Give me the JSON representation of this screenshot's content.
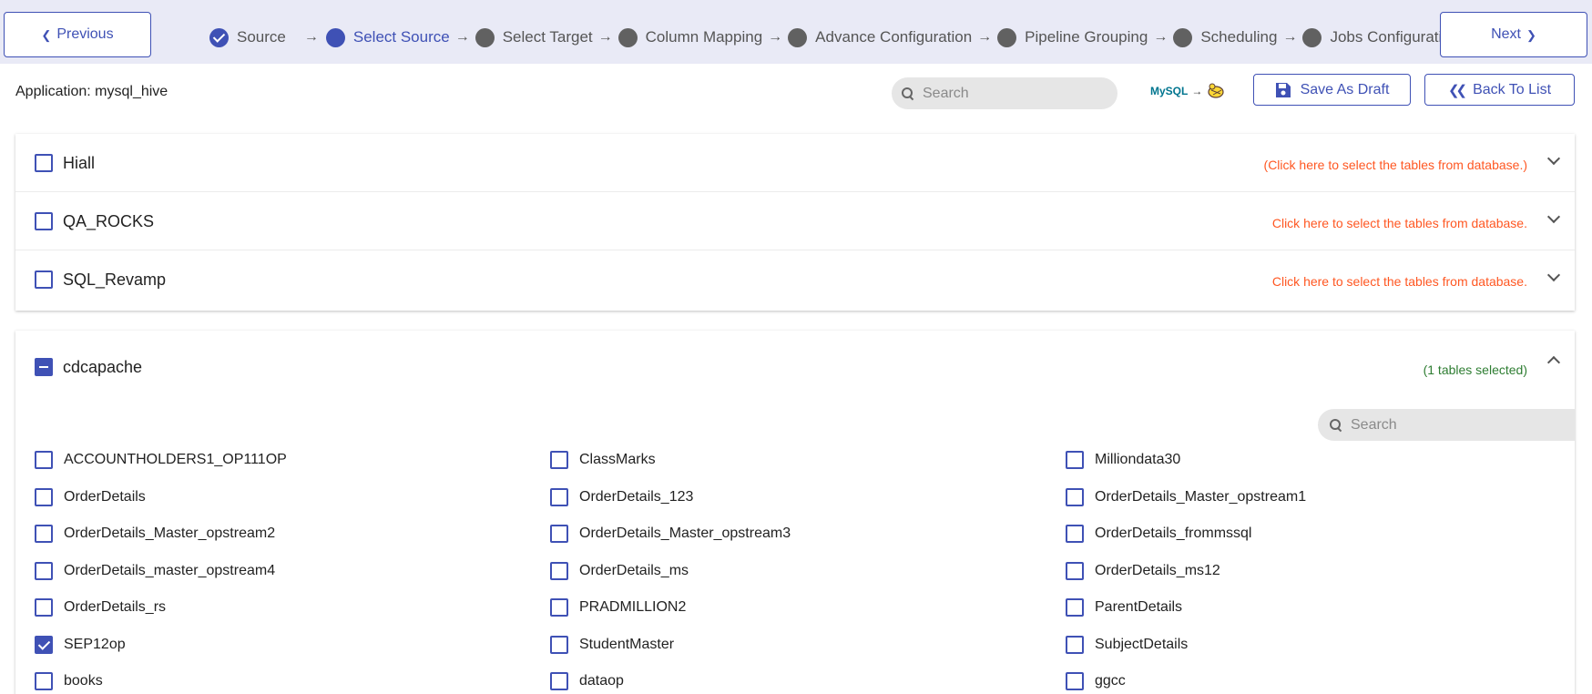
{
  "nav": {
    "previous_label": "Previous",
    "next_label": "Next"
  },
  "stepper": {
    "steps": [
      {
        "label": "Source",
        "state": "done"
      },
      {
        "label": "Select Source",
        "state": "active"
      },
      {
        "label": "Select Target",
        "state": "pending"
      },
      {
        "label": "Column Mapping",
        "state": "pending"
      },
      {
        "label": "Advance Configuration",
        "state": "pending"
      },
      {
        "label": "Pipeline Grouping",
        "state": "pending"
      },
      {
        "label": "Scheduling",
        "state": "pending"
      },
      {
        "label": "Jobs Configuration",
        "state": "pending"
      }
    ],
    "arrow": "→"
  },
  "header": {
    "application_label": "Application: mysql_hive",
    "search_placeholder": "Search",
    "logo_mysql": "MySQL",
    "logo_arrow": "→",
    "save_draft_label": "Save As Draft",
    "back_label": "Back To List"
  },
  "databases": [
    {
      "name": "Hiall",
      "hint": "(Click here to select the tables from database.)",
      "checked": false
    },
    {
      "name": "QA_ROCKS",
      "hint": "Click here to select the tables from database.",
      "checked": false
    },
    {
      "name": "SQL_Revamp",
      "hint": "Click here to select the tables from database.",
      "checked": false
    }
  ],
  "expanded_database": {
    "name": "cdcapache",
    "hint": "(1 tables selected)",
    "state": "indeterminate",
    "search_placeholder": "Search",
    "tables": [
      [
        "ACCOUNTHOLDERS1_OP111OP",
        "ClassMarks",
        "Milliondata30"
      ],
      [
        "OrderDetails",
        "OrderDetails_123",
        "OrderDetails_Master_opstream1"
      ],
      [
        "OrderDetails_Master_opstream2",
        "OrderDetails_Master_opstream3",
        "OrderDetails_frommssql"
      ],
      [
        "OrderDetails_master_opstream4",
        "OrderDetails_ms",
        "OrderDetails_ms12"
      ],
      [
        "OrderDetails_rs",
        "PRADMILLION2",
        "ParentDetails"
      ],
      [
        "SEP12op",
        "StudentMaster",
        "SubjectDetails"
      ],
      [
        "books",
        "dataop",
        "ggcc"
      ]
    ],
    "checked_tables": [
      "SEP12op"
    ]
  },
  "colors": {
    "primary": "#3f51b5",
    "topbar_bg": "#e9eaf6",
    "hint_orange": "#ff5722",
    "hint_green": "#2e7d32",
    "step_pending": "#616161"
  }
}
